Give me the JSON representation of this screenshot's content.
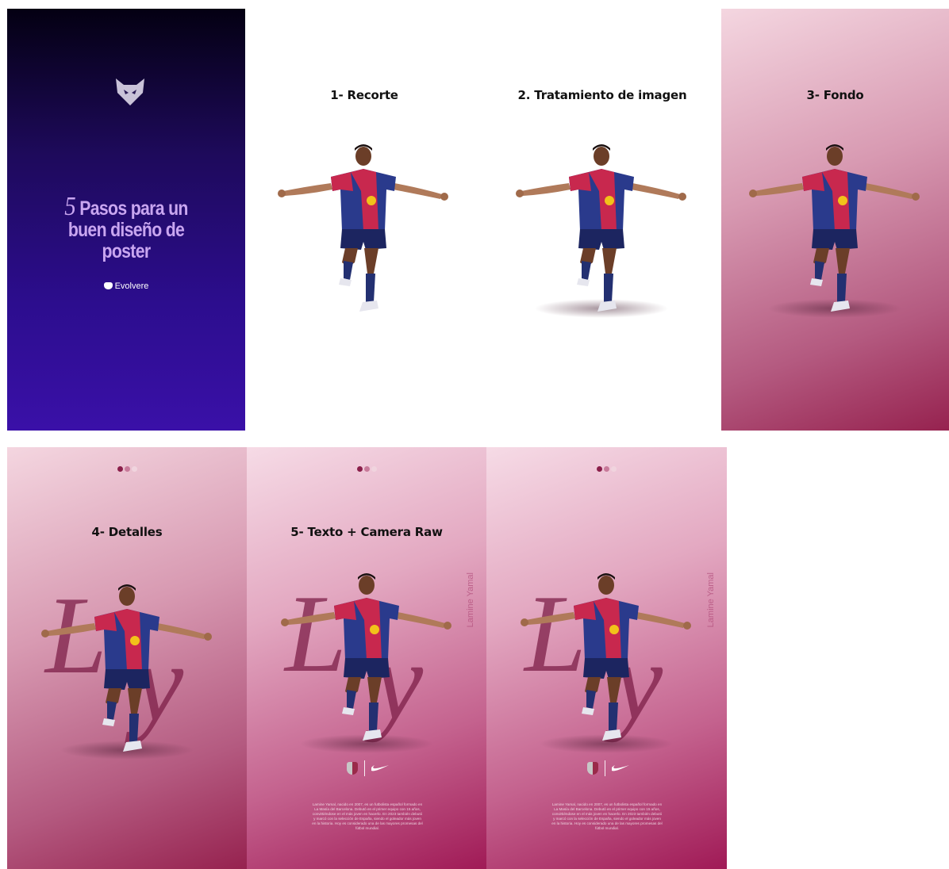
{
  "cover": {
    "number": "5",
    "headline_line1": "Pasos para un",
    "headline_line2": "buen diseño de",
    "headline_line3": "poster",
    "brand": "Evolvere"
  },
  "steps": [
    {
      "title": "1- Recorte"
    },
    {
      "title": "2. Tratamiento de imagen"
    },
    {
      "title": "3- Fondo"
    },
    {
      "title": "4- Detalles"
    },
    {
      "title": "5- Texto + Camera Raw"
    }
  ],
  "poster": {
    "initial_1": "L",
    "initial_2": "y",
    "side_name": "Lamine Yamal",
    "description": "Lamine Yamal, nacido en 2007, es un futbolista español formado en La Masía del Barcelona. Debutó en el primer equipo con 15 años, convirtiéndose en el más joven en hacerlo. En 2023 también debutó y marcó con la selección de España, siendo el goleador más joven en la historia. Hoy es considerado una de las mayores promesas del fútbol mundial."
  },
  "colors": {
    "cover_accent": "#c9a6f0",
    "pink_dark": "#96224f",
    "letter_accent": "#7d1f48"
  }
}
